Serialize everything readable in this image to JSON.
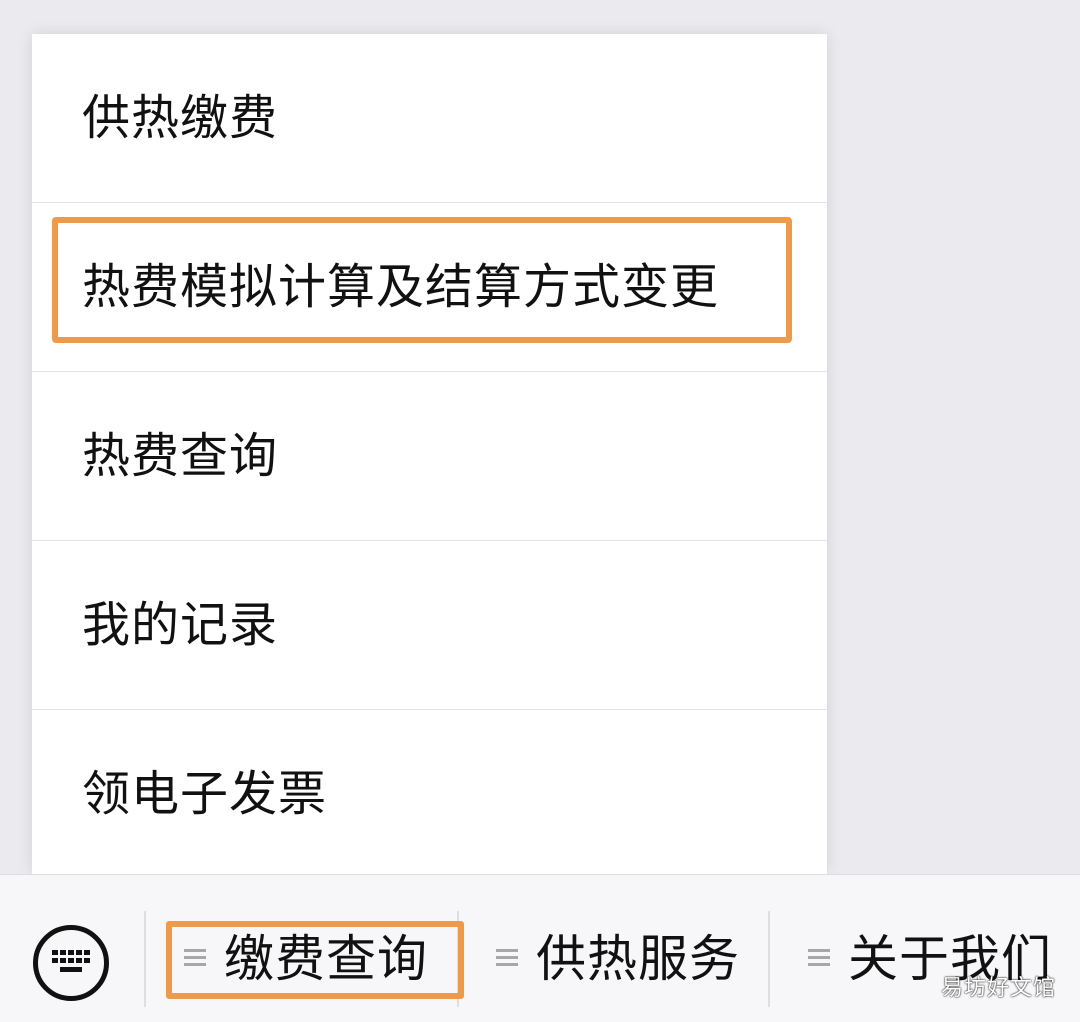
{
  "popup_menu": {
    "items": [
      {
        "label": "供热缴费"
      },
      {
        "label": "热费模拟计算及结算方式变更"
      },
      {
        "label": "热费查询"
      },
      {
        "label": "我的记录"
      },
      {
        "label": "领电子发票"
      }
    ],
    "highlighted_item": "热费模拟计算及结算方式变更"
  },
  "bottom_bar": {
    "keyboard_icon": "keyboard-icon",
    "tabs": [
      {
        "label": "缴费查询",
        "icon": "menu-lines-icon",
        "highlighted": true
      },
      {
        "label": "供热服务",
        "icon": "menu-lines-icon"
      },
      {
        "label": "关于我们",
        "icon": "menu-lines-icon"
      }
    ]
  },
  "watermark": "易坊好文馆",
  "colors": {
    "highlight": "#ee9a4d",
    "background": "#ebeaee",
    "menu_background": "#ffffff"
  }
}
